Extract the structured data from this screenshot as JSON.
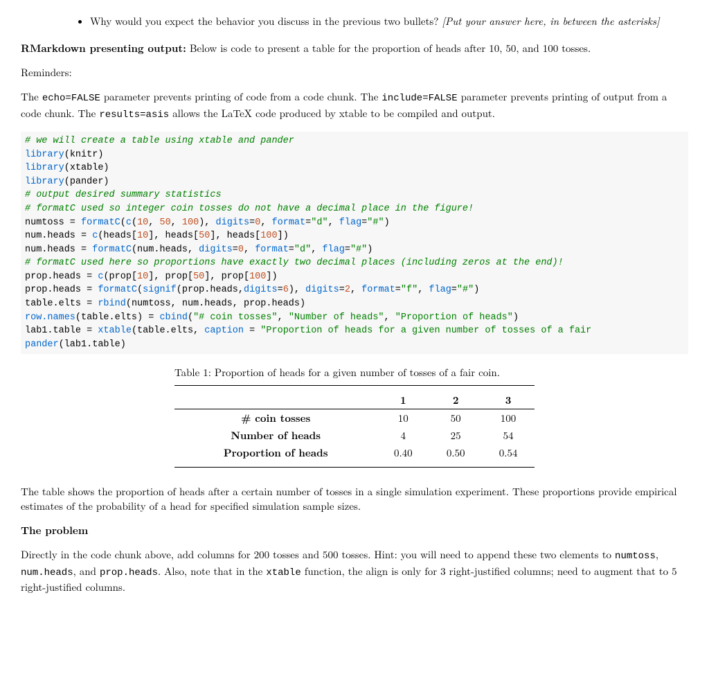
{
  "bullet": {
    "question": "Why would you expect the behavior you discuss in the previous two bullets? ",
    "placeholder": "[Put your answer here, in between the asterisks]"
  },
  "rmarkdown": {
    "heading": "RMarkdown presenting output:",
    "intro_rest": "  Below is code to present a table for the proportion of heads after 10, 50, and 100 tosses."
  },
  "reminders_label": "Reminders:",
  "reminders_para": {
    "t1": "The ",
    "c1": "echo=FALSE",
    "t2": " parameter prevents printing of code from a code chunk. The ",
    "c2": "include=FALSE",
    "t3": " parameter prevents printing of output from a code chunk. The ",
    "c3": "results=asis",
    "t4": " allows the LaTeX code produced by xtable to be compiled and output."
  },
  "code": {
    "l01": "# we will create a table using xtable and pander",
    "l02a": "library",
    "l02b": "(knitr)",
    "l03a": "library",
    "l03b": "(xtable)",
    "l04a": "library",
    "l04b": "(pander)",
    "l05": "# output desired summary statistics",
    "l06": "# formatC used so integer coin tosses do not have a decimal place in the figure!",
    "l07": "numtoss = formatC(c(10, 50, 100), digits=0, format=\"d\", flag=\"#\")",
    "l08": "num.heads = c(heads[10], heads[50], heads[100])",
    "l09": "num.heads = formatC(num.heads, digits=0, format=\"d\", flag=\"#\")",
    "l10": "# formatC used here so proportions have exactly two decimal places (including zeros at the end)!",
    "l11": "prop.heads = c(prop[10], prop[50], prop[100])",
    "l12": "prop.heads = formatC(signif(prop.heads,digits=6), digits=2, format=\"f\", flag=\"#\")",
    "l13": "table.elts = rbind(numtoss, num.heads, prop.heads)",
    "l14": "row.names(table.elts) = cbind(\"# coin tosses\", \"Number of heads\", \"Proportion of heads\")",
    "l15": "lab1.table = xtable(table.elts, caption = \"Proportion of heads for a given number of tosses of a fair",
    "l16": "pander(lab1.table)"
  },
  "table": {
    "caption": "Table 1: Proportion of heads for a given number of tosses of a fair coin.",
    "cols": [
      "1",
      "2",
      "3"
    ],
    "rows": [
      {
        "label": "# coin tosses",
        "v": [
          "10",
          "50",
          "100"
        ]
      },
      {
        "label": "Number of heads",
        "v": [
          "4",
          "25",
          "54"
        ]
      },
      {
        "label": "Proportion of heads",
        "v": [
          "0.40",
          "0.50",
          "0.54"
        ]
      }
    ]
  },
  "table_explain": "The table shows the proportion of heads after a certain number of tosses in a single simulation experiment. These proportions provide empirical estimates of the probability of a head for specified simulation sample sizes.",
  "problem": {
    "heading": "The problem",
    "t1": "Directly in the code chunk above, add columns for 200 tosses and 500 tosses. Hint: you will need to append these two elements to ",
    "c1": "numtoss",
    "t2": ", ",
    "c2": "num.heads",
    "t3": ", and ",
    "c3": "prop.heads",
    "t4": ". Also, note that in the ",
    "c4": "xtable",
    "t5": " function, the align is only for 3 right-justified columns; need to augment that to 5 right-justified columns."
  },
  "chart_data": {
    "type": "table",
    "title": "Proportion of heads for a given number of tosses of a fair coin.",
    "columns": [
      "1",
      "2",
      "3"
    ],
    "rows": [
      {
        "label": "# coin tosses",
        "values": [
          10,
          50,
          100
        ]
      },
      {
        "label": "Number of heads",
        "values": [
          4,
          25,
          54
        ]
      },
      {
        "label": "Proportion of heads",
        "values": [
          0.4,
          0.5,
          0.54
        ]
      }
    ]
  }
}
